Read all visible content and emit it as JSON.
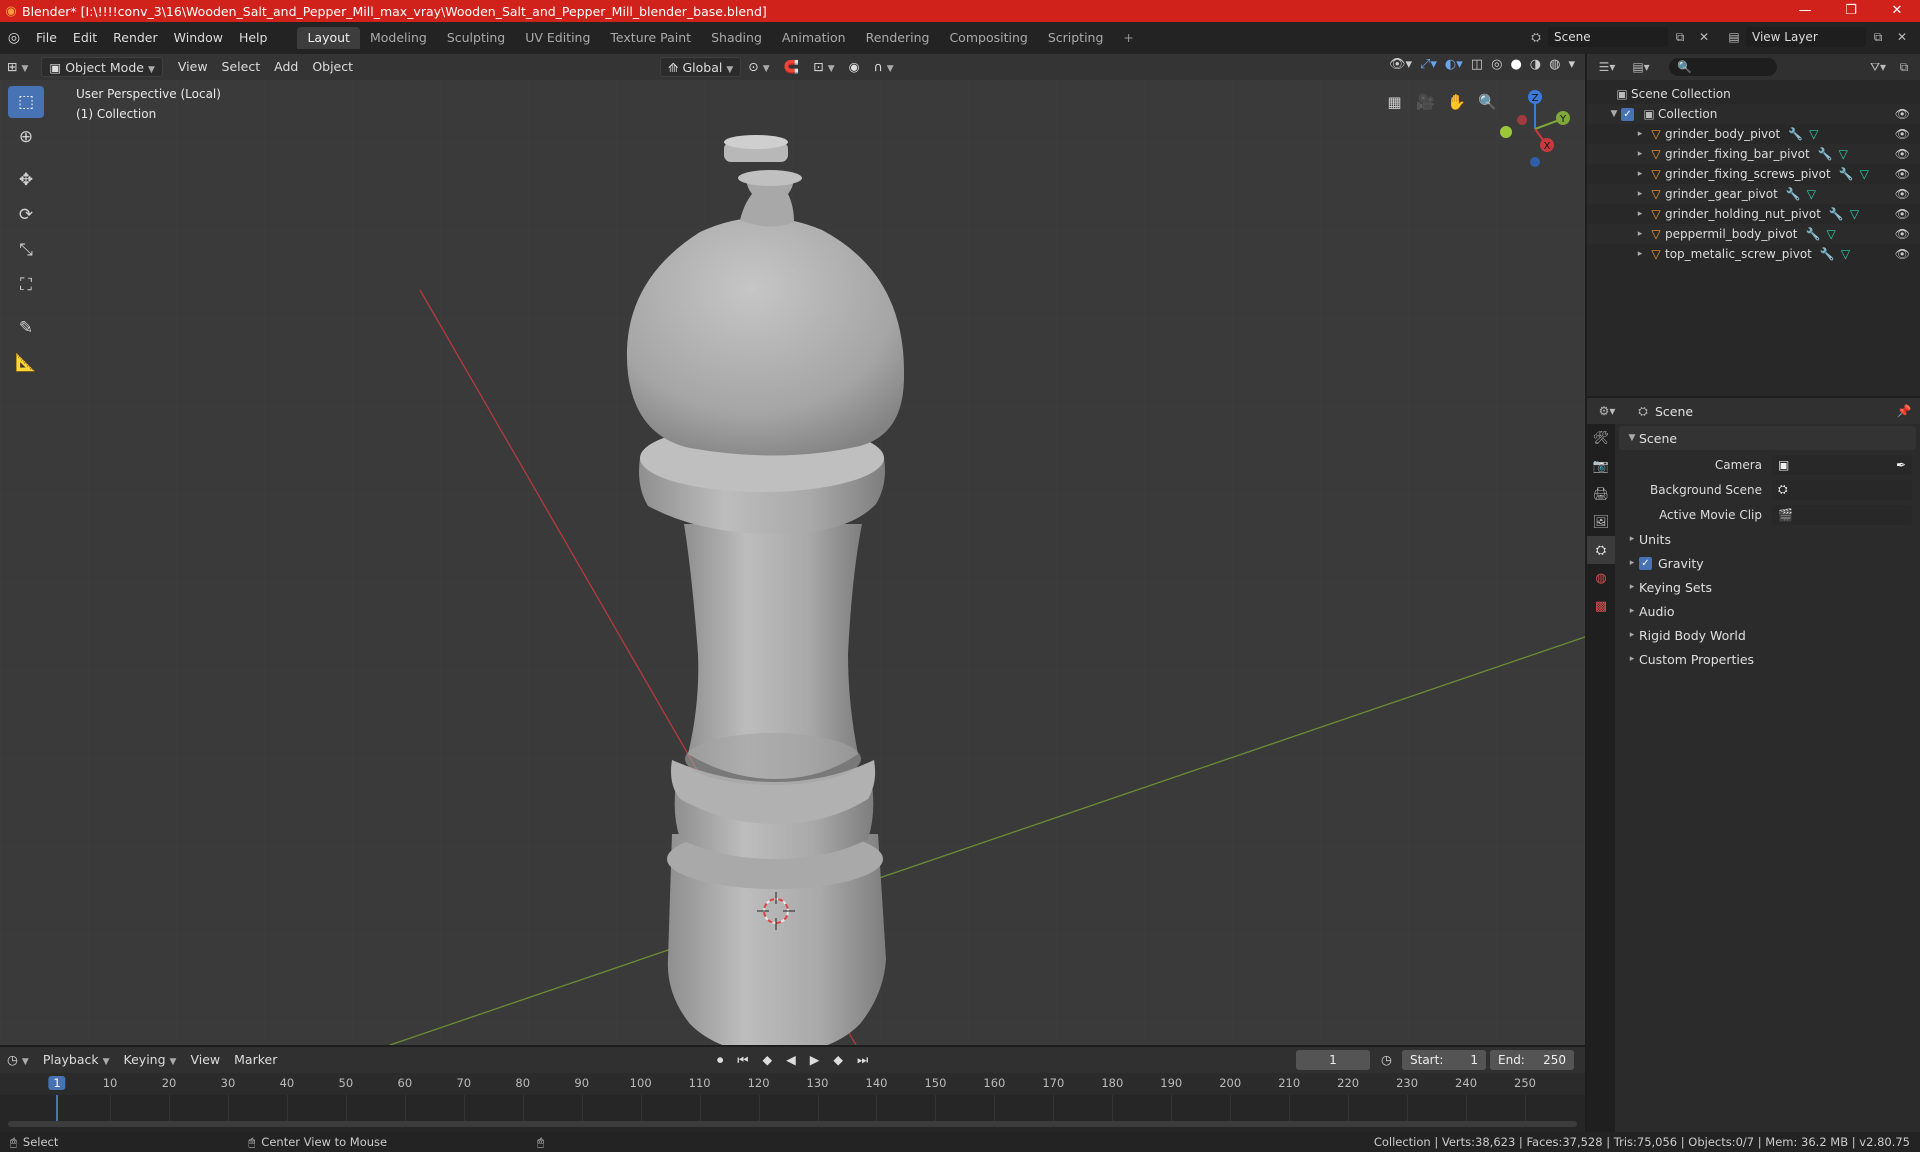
{
  "window": {
    "title": "Blender* [I:\\!!!!conv_3\\16\\Wooden_Salt_and_Pepper_Mill_max_vray\\Wooden_Salt_and_Pepper_Mill_blender_base.blend]",
    "minimize": "—",
    "maximize": "❐",
    "close": "✕"
  },
  "menu": [
    "File",
    "Edit",
    "Render",
    "Window",
    "Help"
  ],
  "workspaces": [
    "Layout",
    "Modeling",
    "Sculpting",
    "UV Editing",
    "Texture Paint",
    "Shading",
    "Animation",
    "Rendering",
    "Compositing",
    "Scripting"
  ],
  "workspace_plus": "+",
  "scene_selector": "Scene",
  "view_layer_selector": "View Layer",
  "viewport": {
    "mode": "Object Mode",
    "menus": [
      "View",
      "Select",
      "Add",
      "Object"
    ],
    "orientation": "Global",
    "info_line1": "User Perspective (Local)",
    "info_line2": "(1) Collection",
    "gizmo_axes": {
      "z": "Z",
      "y": "Y",
      "x": "X"
    }
  },
  "outliner": {
    "root": "Scene Collection",
    "collection": "Collection",
    "objects": [
      "grinder_body_pivot",
      "grinder_fixing_bar_pivot",
      "grinder_fixing_screws_pivot",
      "grinder_gear_pivot",
      "grinder_holding_nut_pivot",
      "peppermil_body_pivot",
      "top_metalic_screw_pivot"
    ]
  },
  "properties": {
    "context": "Scene",
    "panel": "Scene",
    "fields": [
      {
        "label": "Camera",
        "value": ""
      },
      {
        "label": "Background Scene",
        "value": ""
      },
      {
        "label": "Active Movie Clip",
        "value": ""
      }
    ],
    "subpanels": [
      "Units",
      "Gravity",
      "Keying Sets",
      "Audio",
      "Rigid Body World",
      "Custom Properties"
    ],
    "gravity_checked": true
  },
  "timeline": {
    "menus": [
      "Playback",
      "Keying",
      "View",
      "Marker"
    ],
    "current_frame": "1",
    "start_label": "Start:",
    "start": "1",
    "end_label": "End:",
    "end": "250",
    "ruler": [
      "1",
      "10",
      "20",
      "30",
      "40",
      "50",
      "60",
      "70",
      "80",
      "90",
      "100",
      "110",
      "120",
      "130",
      "140",
      "150",
      "160",
      "170",
      "180",
      "190",
      "200",
      "210",
      "220",
      "230",
      "240",
      "250"
    ]
  },
  "statusbar": {
    "left_action": "Select",
    "mid_action": "Center View to Mouse",
    "stats": "Collection | Verts:38,623 | Faces:37,528 | Tris:75,056 | Objects:0/7 | Mem: 36.2 MB | v2.80.75"
  },
  "colors": {
    "titlebar": "#d0211b",
    "accent": "#4772b3",
    "x_axis": "#c8393f",
    "y_axis": "#7fa73a",
    "object_icon": "#f29a3c",
    "mesh_data_icon": "#2ed1a5"
  }
}
